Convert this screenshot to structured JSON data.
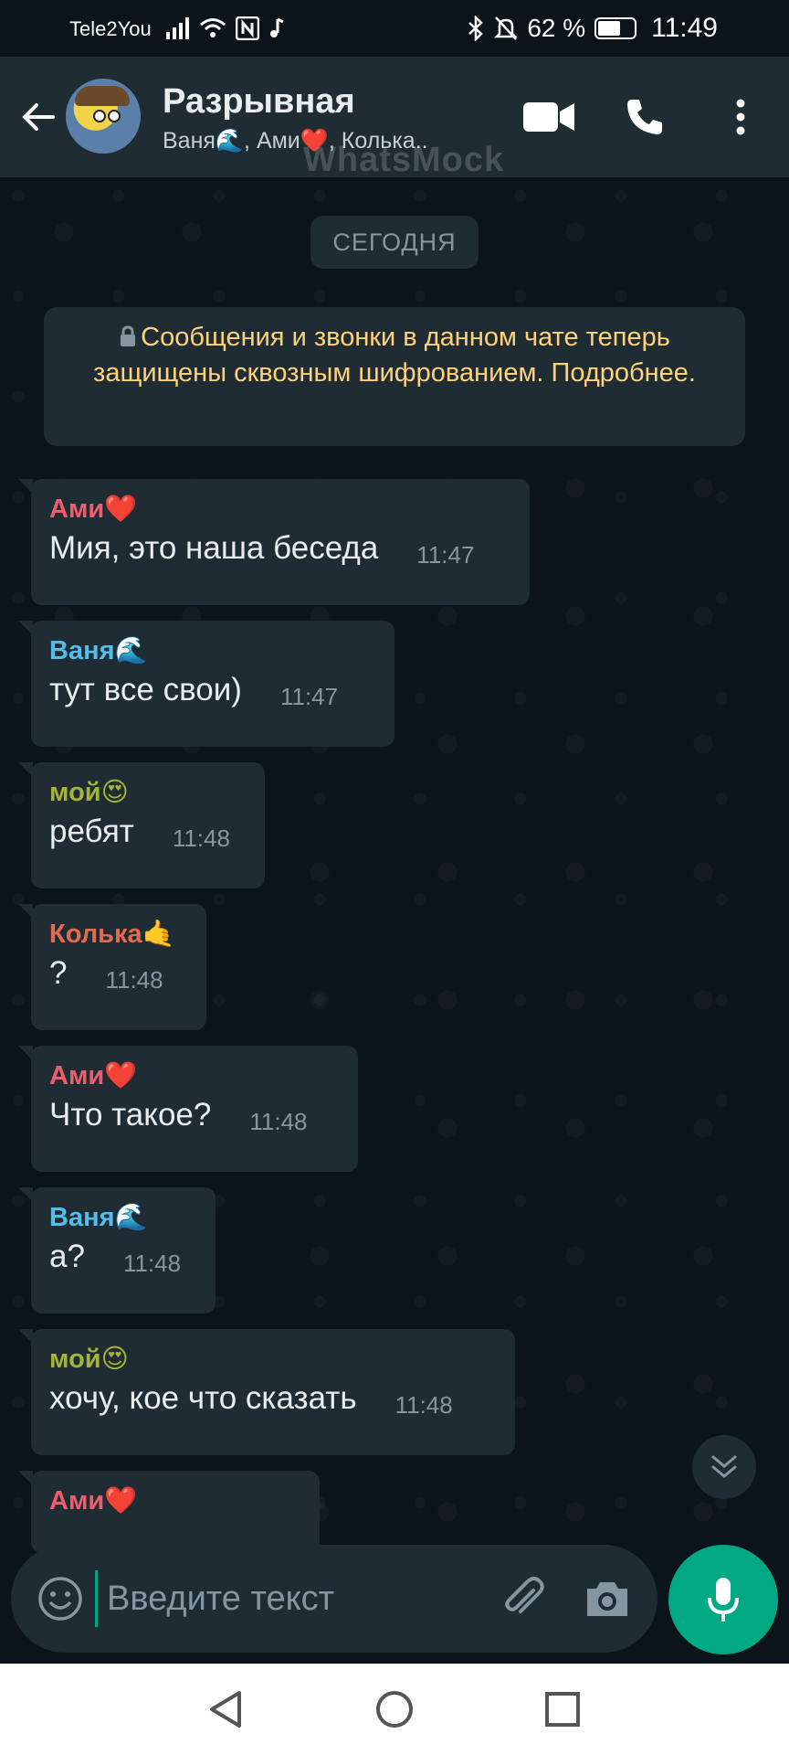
{
  "status_bar": {
    "carrier": "Tele2You",
    "battery_level_text": "62 %",
    "battery_fraction": 0.62,
    "time": "11:49"
  },
  "header": {
    "title": "Разрывная",
    "subtitle": "Ваня🌊, Ами❤️, Колька..",
    "watermark": "WhatsMock",
    "icons": [
      "back-arrow-icon",
      "video-call-icon",
      "voice-call-icon",
      "more-vert-icon"
    ]
  },
  "chat": {
    "date_divider": "СЕГОДНЯ",
    "encryption_notice": "Сообщения и звонки в данном чате теперь защищены сквозным шифрованием. Подробнее.",
    "messages": [
      {
        "sender": "Ами❤️",
        "sender_color": "#f15c6d",
        "text": "Мия, это наша беседа",
        "time": "11:47"
      },
      {
        "sender": "Ваня🌊",
        "sender_color": "#53bdeb",
        "text": "тут все свои)",
        "time": "11:47"
      },
      {
        "sender": "мой😍",
        "sender_color": "#a5b337",
        "text": "ребят",
        "time": "11:48"
      },
      {
        "sender": "Колька🤙",
        "sender_color": "#e26b4f",
        "text": "?",
        "time": "11:48"
      },
      {
        "sender": "Ами❤️",
        "sender_color": "#f15c6d",
        "text": "Что такое?",
        "time": "11:48"
      },
      {
        "sender": "Ваня🌊",
        "sender_color": "#53bdeb",
        "text": "а?",
        "time": "11:48"
      },
      {
        "sender": "мой😍",
        "sender_color": "#a5b337",
        "text": "хочу, кое что сказать",
        "time": "11:48"
      },
      {
        "sender": "Ами❤️",
        "sender_color": "#f15c6d",
        "text": "",
        "time": ""
      }
    ]
  },
  "input": {
    "placeholder": "Введите текст"
  },
  "colors": {
    "background": "#0b141a",
    "bar": "#1f2c34",
    "accent": "#00a884",
    "encryption_text": "#ffd279"
  }
}
